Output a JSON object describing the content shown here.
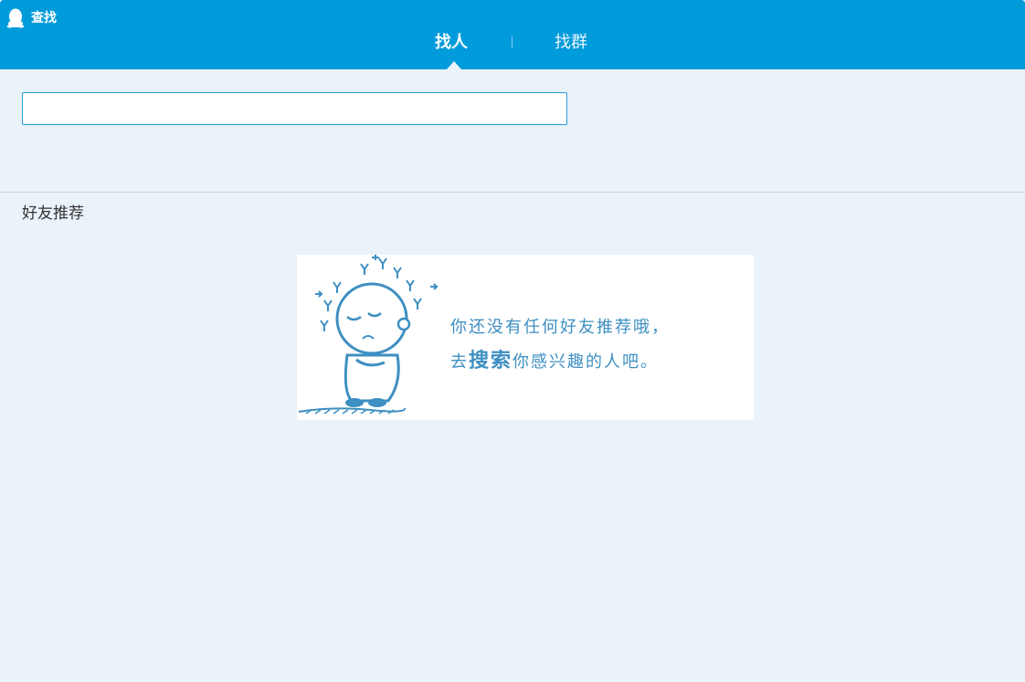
{
  "window": {
    "title": "查找",
    "logo_icon": "qq-penguin-icon"
  },
  "tabs": [
    {
      "label": "找人",
      "active": true
    },
    {
      "label": "找群",
      "active": false
    }
  ],
  "search": {
    "value": "",
    "placeholder": ""
  },
  "recommend": {
    "section_title": "好友推荐",
    "empty_line1": "你还没有任何好友推荐哦，",
    "empty_line2_prefix": "去",
    "empty_line2_emphasis": "搜索",
    "empty_line2_suffix": "你感兴趣的人吧。",
    "illustration_icon": "sad-cartoon-character-icon"
  },
  "colors": {
    "titlebar": "#009bdb",
    "background": "#eaf2fa",
    "accent": "#2a9dd7",
    "illustration": "#3e8fc2"
  }
}
